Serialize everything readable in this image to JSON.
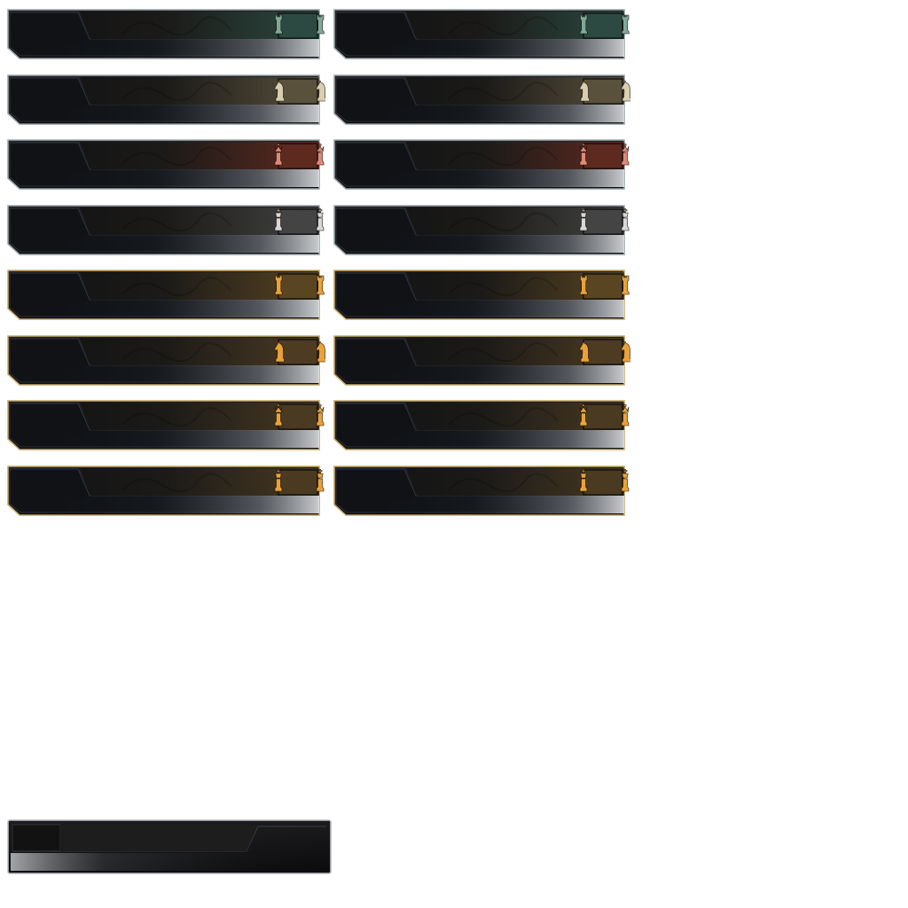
{
  "sheet": {
    "frames": [
      {
        "piece": "rook-icon",
        "accent": "#2c4a41",
        "piece_color": "#7fa89a",
        "trim": "#9aa3a6"
      },
      {
        "piece": "knight-icon",
        "accent": "#5a513d",
        "piece_color": "#d9cfb0",
        "trim": "#9aa3a6"
      },
      {
        "piece": "queen-icon",
        "accent": "#5e2a20",
        "piece_color": "#e08878",
        "trim": "#9aa3a6"
      },
      {
        "piece": "king-icon",
        "accent": "#444444",
        "piece_color": "#d8d8d8",
        "trim": "#9aa3a6"
      },
      {
        "piece": "rook-icon",
        "accent": "#5a4523",
        "piece_color": "#e9a23a",
        "trim": "#c9a76a"
      },
      {
        "piece": "knight-icon",
        "accent": "#4e3c22",
        "piece_color": "#e9a23a",
        "trim": "#c9a76a"
      },
      {
        "piece": "queen-icon",
        "accent": "#4a3a22",
        "piece_color": "#e9a23a",
        "trim": "#c9a76a"
      },
      {
        "piece": "king-icon",
        "accent": "#4a3a22",
        "piece_color": "#e9a23a",
        "trim": "#c9a76a"
      }
    ],
    "empty_frame": {
      "name": "empty-nameplate-frame",
      "accent": "#1d1d1d",
      "trim": "#b8bcc0"
    }
  }
}
